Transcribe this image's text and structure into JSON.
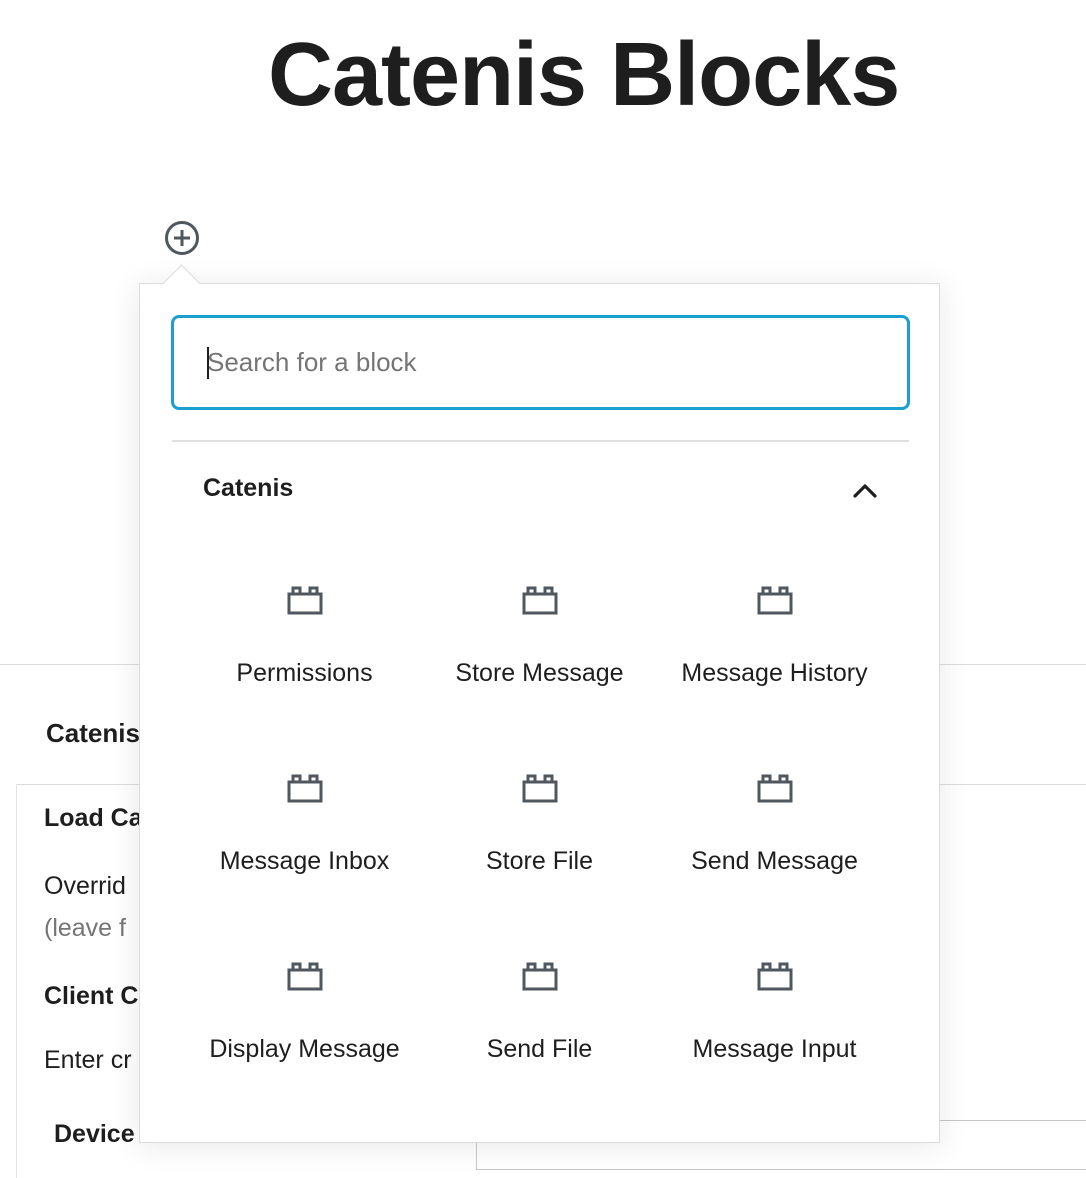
{
  "page": {
    "title": "Catenis Blocks"
  },
  "inserter": {
    "toggle_icon": "plus-circle-icon",
    "search_placeholder": "Search for a block",
    "search_value": "",
    "category": {
      "title": "Catenis",
      "expanded": true,
      "chevron_icon": "chevron-up-icon"
    },
    "blocks": [
      {
        "label": "Permissions",
        "icon": "block-default-icon"
      },
      {
        "label": "Store Message",
        "icon": "block-default-icon"
      },
      {
        "label": "Message History",
        "icon": "block-default-icon"
      },
      {
        "label": "Message Inbox",
        "icon": "block-default-icon"
      },
      {
        "label": "Store File",
        "icon": "block-default-icon"
      },
      {
        "label": "Send Message",
        "icon": "block-default-icon"
      },
      {
        "label": "Display Message",
        "icon": "block-default-icon"
      },
      {
        "label": "Send File",
        "icon": "block-default-icon"
      },
      {
        "label": "Message Input",
        "icon": "block-default-icon"
      }
    ]
  },
  "background_panel": {
    "title": "Catenis",
    "load_label": "Load Ca",
    "override_text": "Overrid",
    "override_hint": "(leave f",
    "client_label": "Client C",
    "enter_text": "Enter cr",
    "device_label": "Device ID"
  },
  "colors": {
    "focus_border": "#1a9fd1",
    "text": "#1e1e1e",
    "muted": "#757575",
    "icon": "#50575e"
  }
}
